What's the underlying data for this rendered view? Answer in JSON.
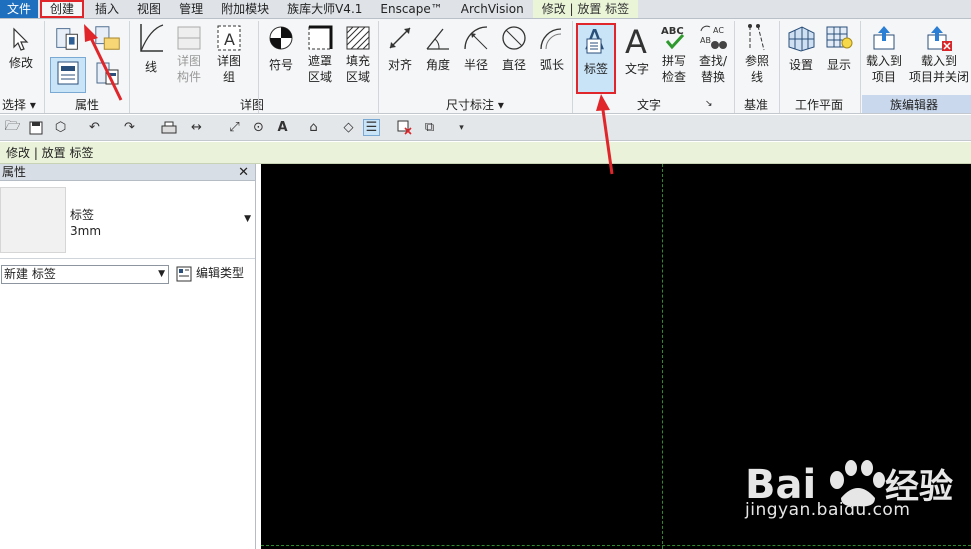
{
  "tabs": [
    "文件",
    "创建",
    "插入",
    "视图",
    "管理",
    "附加模块",
    "族库大师V4.1",
    "Enscape™",
    "ArchVision",
    "修改 | 放置 标签"
  ],
  "ribbon": {
    "select": {
      "modify": "修改",
      "panel": "选择"
    },
    "properties": {
      "panel": "属性"
    },
    "detail": {
      "line": "线",
      "detail_comp_1": "详图",
      "detail_comp_2": "构件",
      "detail_group_1": "详图",
      "detail_group_2": "组",
      "panel": "详图"
    },
    "symbol": "符号",
    "masking_1": "遮罩",
    "masking_2": "区域",
    "filled_1": "填充",
    "filled_2": "区域",
    "dimension": {
      "aligned": "对齐",
      "angular": "角度",
      "radial": "半径",
      "diameter": "直径",
      "arc": "弧长",
      "panel": "尺寸标注"
    },
    "text": {
      "label": "标签",
      "text": "文字",
      "spell_1": "拼写",
      "spell_2": "检查",
      "find_1": "查找/",
      "find_2": "替换",
      "panel": "文字"
    },
    "datum": {
      "ref_1": "参照",
      "ref_2": "线",
      "panel": "基准"
    },
    "workplane": {
      "set": "设置",
      "show": "显示",
      "panel": "工作平面"
    },
    "family_editor": {
      "load_1": "载入到",
      "load_2": "项目",
      "loadclose_1": "载入到",
      "loadclose_2": "项目并关闭",
      "panel": "族编辑器"
    }
  },
  "context_bar": "修改 | 放置 标签",
  "properties": {
    "title": "属性",
    "close": "✕",
    "type_name_1": "标签",
    "type_name_2": "3mm",
    "new_select": "新建 标签",
    "edit_type": "编辑类型"
  },
  "watermark": {
    "brand": "Bai",
    "cn": "经验",
    "url": "jingyan.baidu.com"
  },
  "colors": {
    "accent_red": "#e0262a",
    "file_tab": "#1f6fbf",
    "canvas": "#000000",
    "guide": "#2d8a2d"
  }
}
